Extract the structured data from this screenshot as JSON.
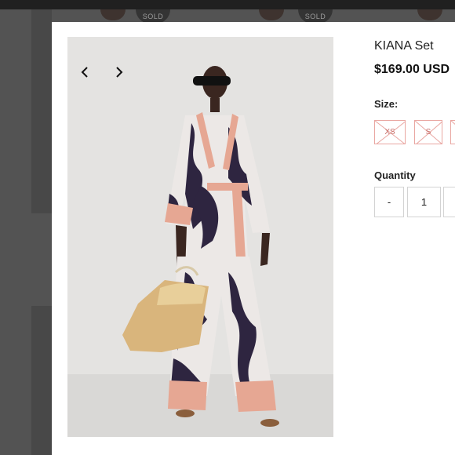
{
  "background": {
    "badges": [
      "SOLD",
      "SOLD"
    ]
  },
  "product": {
    "title": "KIANA Set",
    "price": "$169.00 USD"
  },
  "gallery": {
    "prev_icon": "chevron-left-icon",
    "next_icon": "chevron-right-icon"
  },
  "size": {
    "label": "Size:",
    "options": [
      {
        "label": "XS",
        "available": false
      },
      {
        "label": "S",
        "available": false
      },
      {
        "label": "",
        "available": false
      }
    ]
  },
  "quantity": {
    "label": "Quantity",
    "decrement_label": "-",
    "value": "1",
    "increment_label": "+"
  },
  "colors": {
    "sold_out_border": "#e9a7a2",
    "sold_out_text": "#c76f6a",
    "photo_background": "#e4e3e1",
    "print_dark": "#2e2540",
    "trim_pink": "#e6a793"
  }
}
